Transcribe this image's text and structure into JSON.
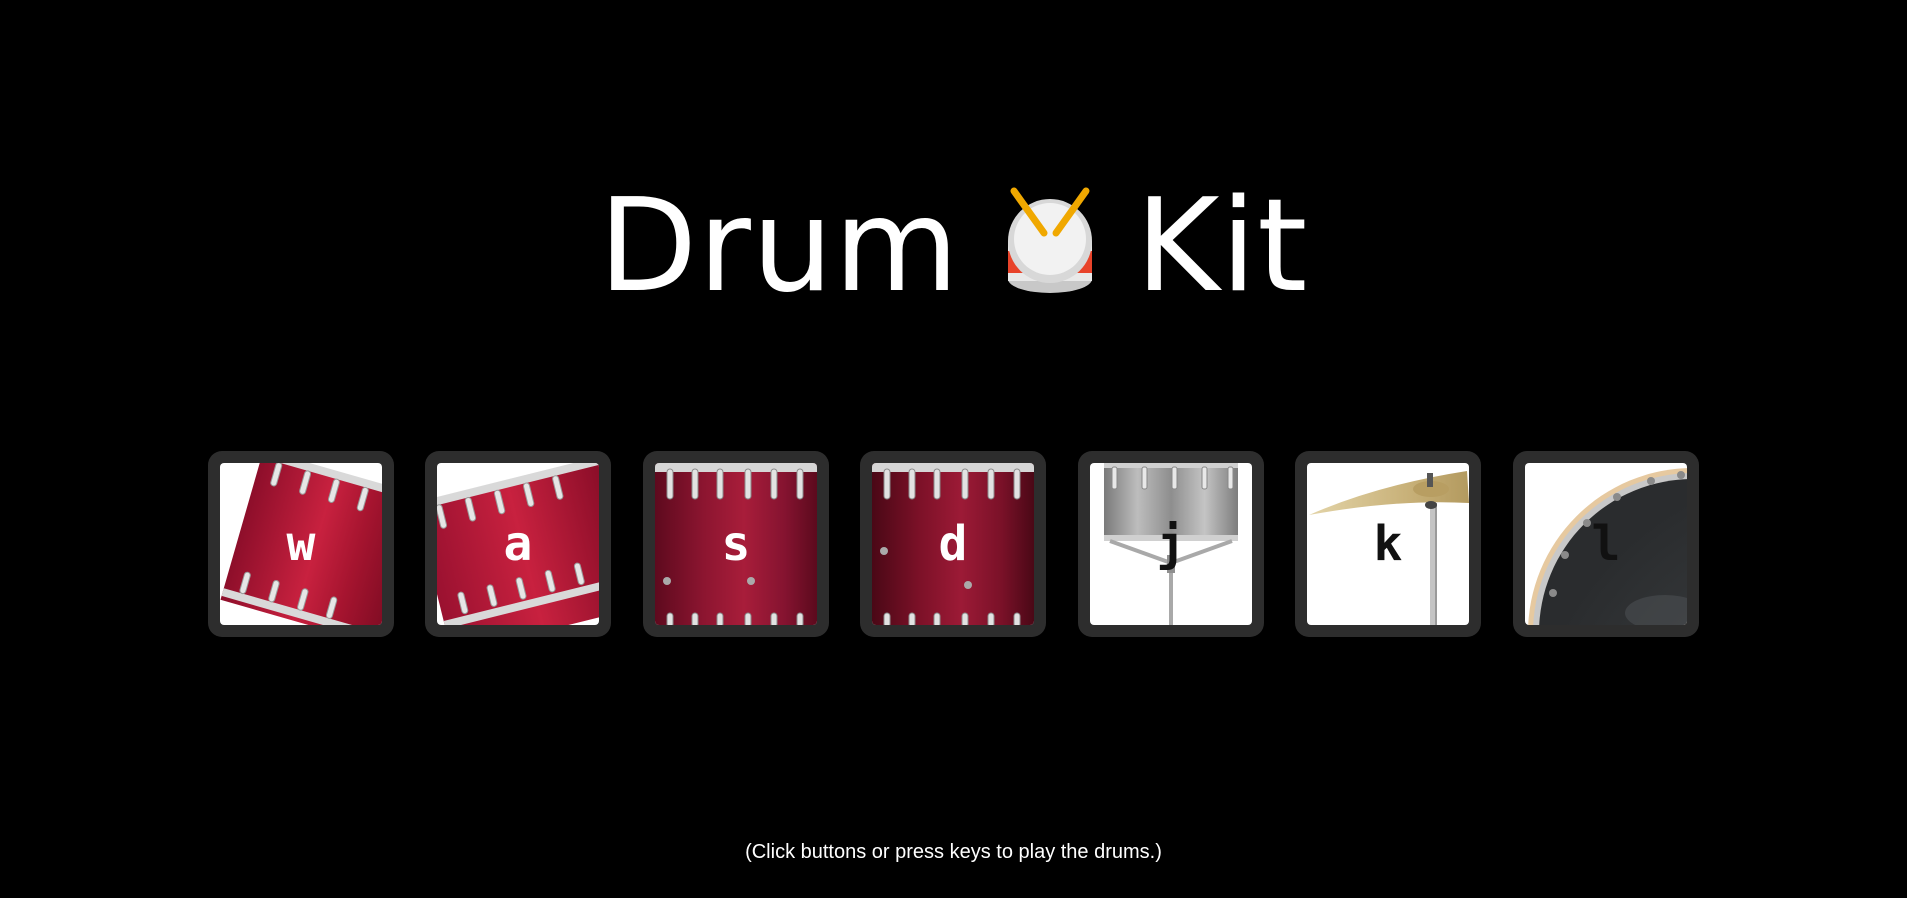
{
  "header": {
    "title_before": "Drum",
    "title_icon": "drum-emoji-icon",
    "title_after": "Kit"
  },
  "pads": [
    {
      "key": "w",
      "icon": "tom-drum-tilted-icon"
    },
    {
      "key": "a",
      "icon": "tom-drum-tilted-icon"
    },
    {
      "key": "s",
      "icon": "snare-drum-icon"
    },
    {
      "key": "d",
      "icon": "snare-drum-icon"
    },
    {
      "key": "j",
      "icon": "snare-stand-icon"
    },
    {
      "key": "k",
      "icon": "crash-cymbal-icon"
    },
    {
      "key": "l",
      "icon": "bass-drum-icon"
    }
  ],
  "footer": {
    "instructions": "(Click buttons or press keys to play the drums.)"
  },
  "colors": {
    "background": "#000000",
    "pad_frame": "#2d2d2d",
    "drum_red": "#b3173a",
    "text": "#ffffff"
  }
}
